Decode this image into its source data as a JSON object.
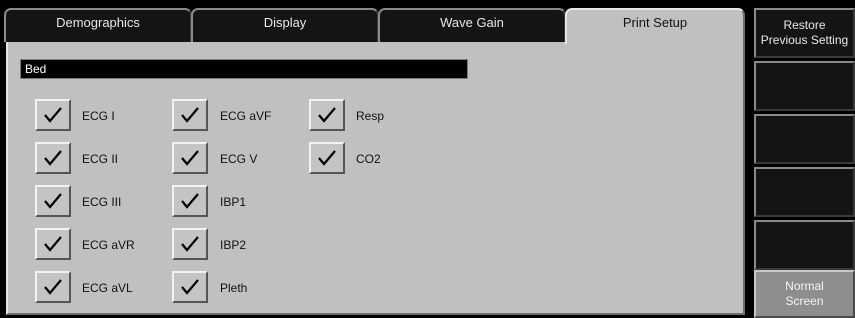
{
  "tabs": [
    {
      "label": "Demographics"
    },
    {
      "label": "Display"
    },
    {
      "label": "Wave Gain"
    },
    {
      "label": "Print Setup",
      "active": true
    }
  ],
  "bed_field": {
    "value": "Bed"
  },
  "checkboxes": [
    {
      "label": "ECG I",
      "checked": true
    },
    {
      "label": "ECG II",
      "checked": true
    },
    {
      "label": "ECG III",
      "checked": true
    },
    {
      "label": "ECG aVR",
      "checked": true
    },
    {
      "label": "ECG aVL",
      "checked": true
    },
    {
      "label": "ECG aVF",
      "checked": true
    },
    {
      "label": "ECG V",
      "checked": true
    },
    {
      "label": "IBP1",
      "checked": true
    },
    {
      "label": "IBP2",
      "checked": true
    },
    {
      "label": "Pleth",
      "checked": true
    },
    {
      "label": "Resp",
      "checked": true
    },
    {
      "label": "CO2",
      "checked": true
    }
  ],
  "side_buttons": [
    {
      "line1": "Restore",
      "line2": "Previous Setting"
    },
    {
      "line1": "",
      "line2": ""
    },
    {
      "line1": "",
      "line2": ""
    },
    {
      "line1": "",
      "line2": ""
    },
    {
      "line1": "",
      "line2": ""
    },
    {
      "line1": "Normal",
      "line2": "Screen"
    }
  ],
  "colors": {
    "panel": "#c0c0c0",
    "background": "#000000",
    "normal_button": "#8e8e8e"
  },
  "icons": {
    "checkbox": "checkmark-icon"
  }
}
